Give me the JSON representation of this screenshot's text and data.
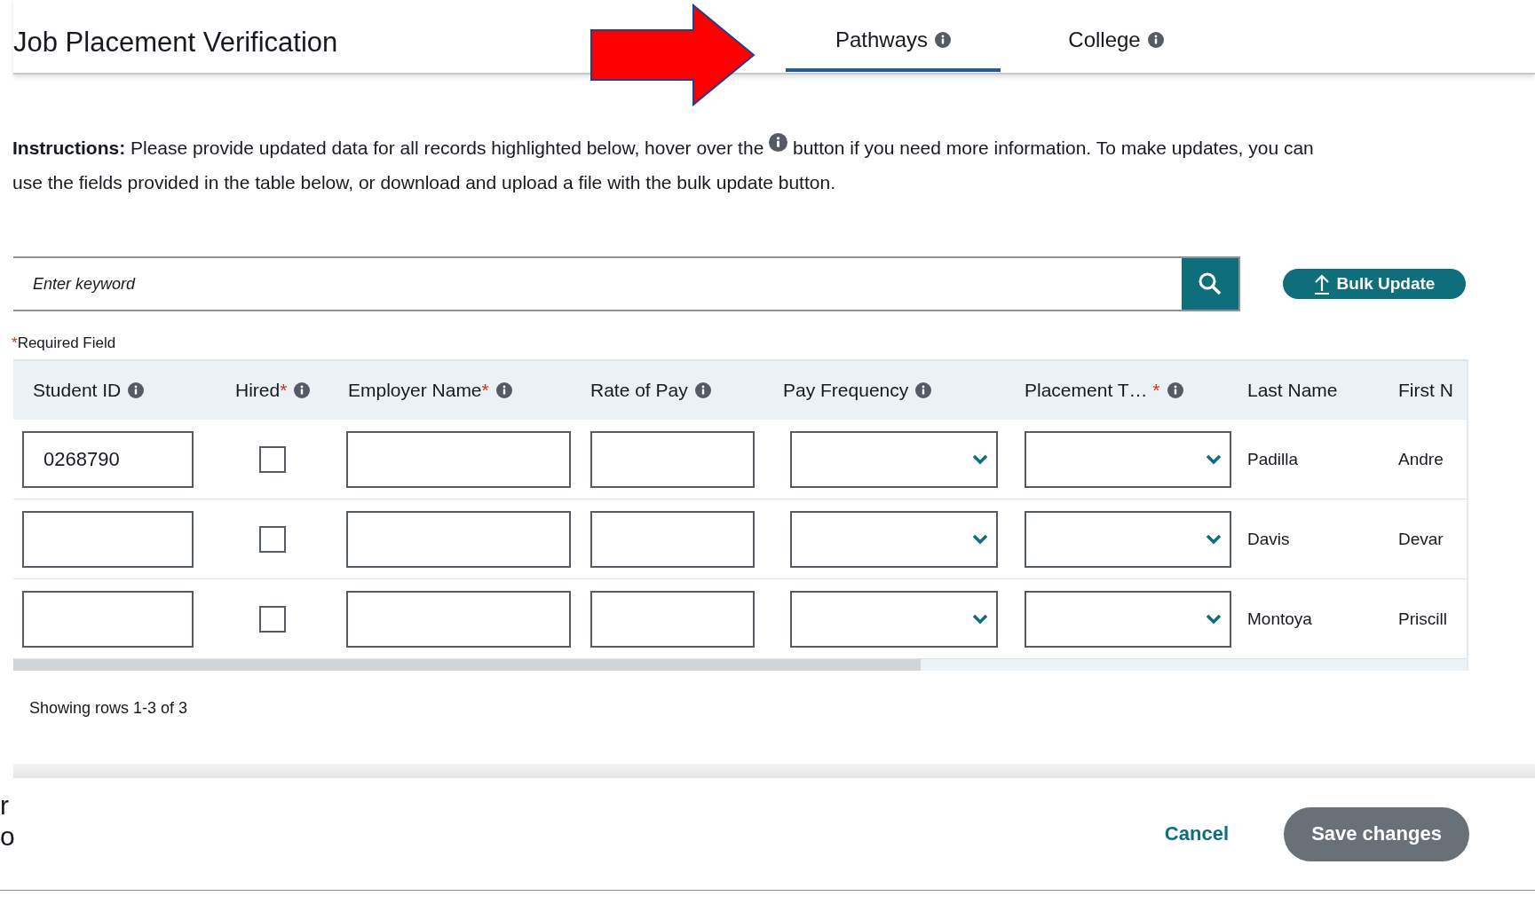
{
  "header": {
    "title": "Job Placement Verification"
  },
  "tabs": [
    {
      "label": "Pathways",
      "info": true,
      "selected": true
    },
    {
      "label": "College",
      "info": true,
      "selected": false
    }
  ],
  "instructions": {
    "label": "Instructions:",
    "text_before": "Please provide updated data for all records highlighted below, hover over the",
    "text_after": "button if you need more information. To make updates, you can use the fields provided in the table below, or download and upload a file with the bulk update button."
  },
  "search": {
    "placeholder": "Enter keyword"
  },
  "bulk_update": {
    "label": "Bulk Update"
  },
  "required_note": {
    "mark": "*",
    "text": "Required Field"
  },
  "table": {
    "columns": [
      {
        "label": "Student ID",
        "required": false,
        "info": true,
        "kind": "input"
      },
      {
        "label": "Hired",
        "required": true,
        "info": true,
        "kind": "checkbox"
      },
      {
        "label": "Employer Name",
        "required": true,
        "info": true,
        "kind": "input"
      },
      {
        "label": "Rate of Pay",
        "required": false,
        "info": true,
        "kind": "input"
      },
      {
        "label": "Pay Frequency",
        "required": false,
        "info": true,
        "kind": "select"
      },
      {
        "label": "Placement T… ",
        "required": true,
        "info": true,
        "kind": "select"
      },
      {
        "label": "Last Name",
        "required": false,
        "info": false,
        "kind": "text"
      },
      {
        "label": "First N",
        "required": false,
        "info": false,
        "kind": "text"
      }
    ],
    "rows": [
      {
        "cells": [
          {
            "value": "0268790"
          },
          {
            "checked": false
          },
          {},
          {},
          {},
          {},
          {
            "value": "Padilla"
          },
          {
            "value": "Andre"
          }
        ]
      },
      {
        "cells": [
          {},
          {
            "checked": false
          },
          {},
          {},
          {},
          {},
          {
            "value": "Davis"
          },
          {
            "value": "Devar"
          }
        ]
      },
      {
        "cells": [
          {},
          {
            "checked": false
          },
          {},
          {},
          {},
          {},
          {
            "value": "Montoya"
          },
          {
            "value": "Priscill"
          }
        ]
      }
    ]
  },
  "pagination": {
    "text": "Showing rows 1-3 of 3"
  },
  "background_text": [
    "r",
    "o"
  ],
  "footer": {
    "cancel": "Cancel",
    "save": "Save changes"
  }
}
